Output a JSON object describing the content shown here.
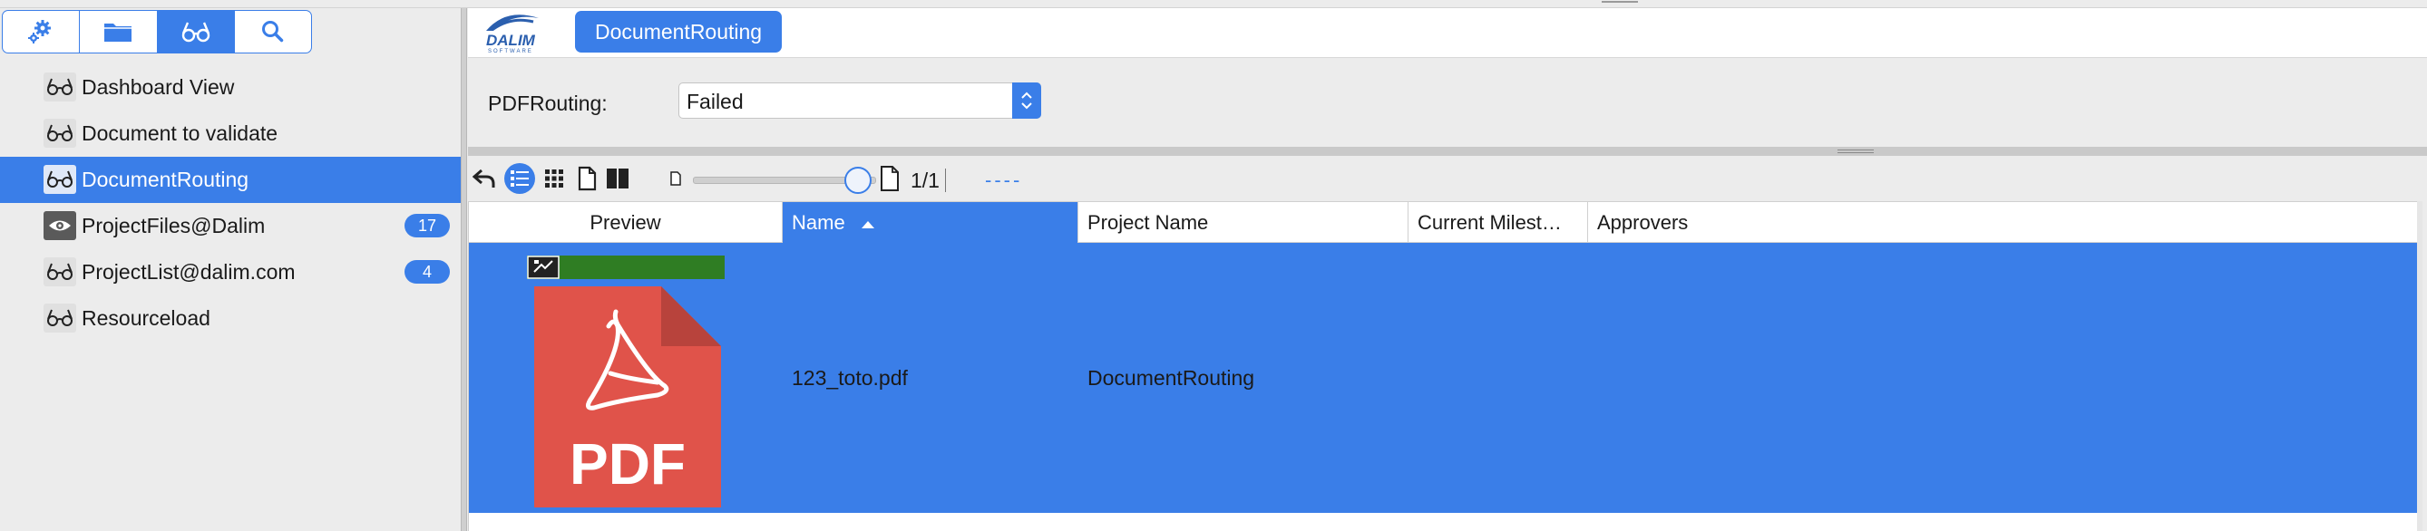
{
  "sidebar": {
    "modes": [
      {
        "name": "settings",
        "icon": "gear-icon"
      },
      {
        "name": "folder",
        "icon": "folder-icon"
      },
      {
        "name": "views",
        "icon": "glasses-icon"
      },
      {
        "name": "search",
        "icon": "search-icon"
      }
    ],
    "active_mode": "views",
    "items": [
      {
        "label": "Dashboard View",
        "icon": "glasses-icon"
      },
      {
        "label": "Document to validate",
        "icon": "glasses-icon"
      },
      {
        "label": "DocumentRouting",
        "icon": "glasses-icon",
        "selected": true
      },
      {
        "label": "ProjectFiles@Dalim",
        "icon": "eye-icon",
        "badge": "17"
      },
      {
        "label": "ProjectList@dalim.com",
        "icon": "glasses-icon",
        "badge": "4"
      },
      {
        "label": "Resourceload",
        "icon": "glasses-icon"
      }
    ]
  },
  "header": {
    "logo": "DALIM SOFTWARE",
    "active_tab": "DocumentRouting"
  },
  "filter": {
    "label": "PDFRouting:",
    "value": "Failed"
  },
  "toolbar": {
    "page_count": "1/1",
    "dashes": "----",
    "zoom_level": 0.9
  },
  "table": {
    "columns": [
      {
        "label": "Preview"
      },
      {
        "label": "Name",
        "sorted": "ascending"
      },
      {
        "label": "Project Name"
      },
      {
        "label": "Current Milest…"
      },
      {
        "label": "Approvers"
      }
    ],
    "rows": [
      {
        "name": "123_toto.pdf",
        "project_name": "DocumentRouting",
        "current_milestone": "",
        "approvers": "",
        "thumb_text": "PDF"
      }
    ]
  },
  "colors": {
    "accent": "#3a7ee8",
    "pdf_red": "#e0534a",
    "status_green": "#2f7d23"
  }
}
